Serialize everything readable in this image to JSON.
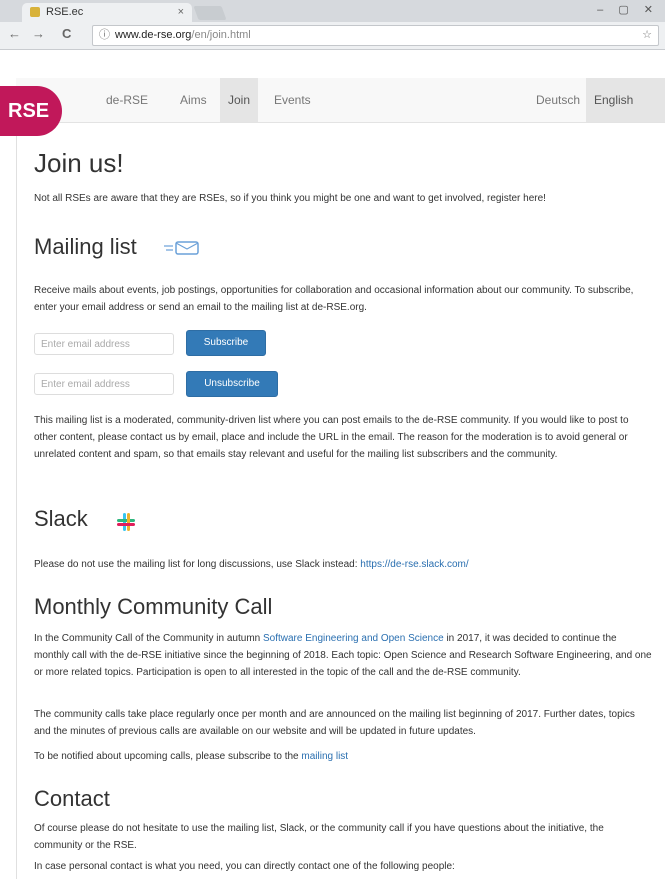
{
  "browser": {
    "tab_title": "RSE.ec",
    "tab_close": "×",
    "window_controls": "– ▢ ✕",
    "back": "←",
    "forward": "→",
    "reload": "C",
    "info": "ⓘ",
    "url_host": "www.de-rse.org",
    "url_path": "/en/join.html",
    "star": "☆"
  },
  "site_nav": {
    "logo": "RSE",
    "links": [
      "de-RSE",
      "Aims",
      "Join",
      "Events"
    ],
    "active_index": 2,
    "lang_de": "Deutsch",
    "lang_en": "English"
  },
  "content": {
    "title": "Join us!",
    "intro": "Not all RSEs are aware that they are RSEs, so if you think you might be one and want to get involved, register here!",
    "mailing": {
      "heading": "Mailing list",
      "desc": "Receive mails about events, job postings, opportunities for collaboration and occasional information about our community. To subscribe, enter your email address or send an email to the mailing list at de-RSE.org.",
      "subscribe_placeholder": "Enter email address",
      "subscribe_button": "Subscribe",
      "unsubscribe_placeholder": "Enter email address",
      "unsubscribe_button": "Unsubscribe",
      "note": "This mailing list is a moderated, community-driven list where you can post emails to the de-RSE community. If you would like to post to other content, please contact us by email, place and include the URL in the email. The reason for the moderation is to avoid general or unrelated content and spam, so that emails stay relevant and useful for the mailing list subscribers and the community."
    },
    "slack": {
      "heading": "Slack",
      "text_pre": "Please do not use the mailing list for long discussions, use Slack instead: ",
      "link": "https://de-rse.slack.com/"
    },
    "call": {
      "heading": "Monthly Community Call",
      "p1_pre": "In the Community Call of the Community in autumn ",
      "p1_link": "Software Engineering and Open Science",
      "p1_post": " in 2017, it was decided to continue the monthly call with the de-RSE initiative since the beginning of 2018. Each topic: Open Science and Research Software Engineering, and one or more related topics. Participation is open to all interested in the topic of the call and the de-RSE community.",
      "p2": "The community calls take place regularly once per month and are announced on the mailing list beginning of 2017. Further dates, topics and the minutes of previous calls are available on our website and will be updated in future updates.",
      "p3_pre": "To be notified about upcoming calls, please subscribe to the ",
      "p3_link": "mailing list"
    },
    "contact": {
      "heading": "Contact",
      "p1": "Of course please do not hesitate to use the mailing list, Slack, or the community call if you have questions about the initiative, the community or the RSE.",
      "p2": "In case personal contact is what you need, you can directly contact one of the following people:"
    }
  }
}
